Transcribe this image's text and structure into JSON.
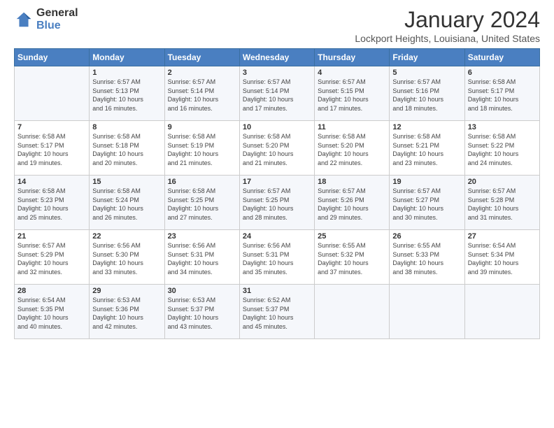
{
  "logo": {
    "general": "General",
    "blue": "Blue"
  },
  "title": "January 2024",
  "location": "Lockport Heights, Louisiana, United States",
  "days_of_week": [
    "Sunday",
    "Monday",
    "Tuesday",
    "Wednesday",
    "Thursday",
    "Friday",
    "Saturday"
  ],
  "weeks": [
    [
      {
        "day": "",
        "info": ""
      },
      {
        "day": "1",
        "info": "Sunrise: 6:57 AM\nSunset: 5:13 PM\nDaylight: 10 hours\nand 16 minutes."
      },
      {
        "day": "2",
        "info": "Sunrise: 6:57 AM\nSunset: 5:14 PM\nDaylight: 10 hours\nand 16 minutes."
      },
      {
        "day": "3",
        "info": "Sunrise: 6:57 AM\nSunset: 5:14 PM\nDaylight: 10 hours\nand 17 minutes."
      },
      {
        "day": "4",
        "info": "Sunrise: 6:57 AM\nSunset: 5:15 PM\nDaylight: 10 hours\nand 17 minutes."
      },
      {
        "day": "5",
        "info": "Sunrise: 6:57 AM\nSunset: 5:16 PM\nDaylight: 10 hours\nand 18 minutes."
      },
      {
        "day": "6",
        "info": "Sunrise: 6:58 AM\nSunset: 5:17 PM\nDaylight: 10 hours\nand 18 minutes."
      }
    ],
    [
      {
        "day": "7",
        "info": "Sunrise: 6:58 AM\nSunset: 5:17 PM\nDaylight: 10 hours\nand 19 minutes."
      },
      {
        "day": "8",
        "info": "Sunrise: 6:58 AM\nSunset: 5:18 PM\nDaylight: 10 hours\nand 20 minutes."
      },
      {
        "day": "9",
        "info": "Sunrise: 6:58 AM\nSunset: 5:19 PM\nDaylight: 10 hours\nand 21 minutes."
      },
      {
        "day": "10",
        "info": "Sunrise: 6:58 AM\nSunset: 5:20 PM\nDaylight: 10 hours\nand 21 minutes."
      },
      {
        "day": "11",
        "info": "Sunrise: 6:58 AM\nSunset: 5:20 PM\nDaylight: 10 hours\nand 22 minutes."
      },
      {
        "day": "12",
        "info": "Sunrise: 6:58 AM\nSunset: 5:21 PM\nDaylight: 10 hours\nand 23 minutes."
      },
      {
        "day": "13",
        "info": "Sunrise: 6:58 AM\nSunset: 5:22 PM\nDaylight: 10 hours\nand 24 minutes."
      }
    ],
    [
      {
        "day": "14",
        "info": "Sunrise: 6:58 AM\nSunset: 5:23 PM\nDaylight: 10 hours\nand 25 minutes."
      },
      {
        "day": "15",
        "info": "Sunrise: 6:58 AM\nSunset: 5:24 PM\nDaylight: 10 hours\nand 26 minutes."
      },
      {
        "day": "16",
        "info": "Sunrise: 6:58 AM\nSunset: 5:25 PM\nDaylight: 10 hours\nand 27 minutes."
      },
      {
        "day": "17",
        "info": "Sunrise: 6:57 AM\nSunset: 5:25 PM\nDaylight: 10 hours\nand 28 minutes."
      },
      {
        "day": "18",
        "info": "Sunrise: 6:57 AM\nSunset: 5:26 PM\nDaylight: 10 hours\nand 29 minutes."
      },
      {
        "day": "19",
        "info": "Sunrise: 6:57 AM\nSunset: 5:27 PM\nDaylight: 10 hours\nand 30 minutes."
      },
      {
        "day": "20",
        "info": "Sunrise: 6:57 AM\nSunset: 5:28 PM\nDaylight: 10 hours\nand 31 minutes."
      }
    ],
    [
      {
        "day": "21",
        "info": "Sunrise: 6:57 AM\nSunset: 5:29 PM\nDaylight: 10 hours\nand 32 minutes."
      },
      {
        "day": "22",
        "info": "Sunrise: 6:56 AM\nSunset: 5:30 PM\nDaylight: 10 hours\nand 33 minutes."
      },
      {
        "day": "23",
        "info": "Sunrise: 6:56 AM\nSunset: 5:31 PM\nDaylight: 10 hours\nand 34 minutes."
      },
      {
        "day": "24",
        "info": "Sunrise: 6:56 AM\nSunset: 5:31 PM\nDaylight: 10 hours\nand 35 minutes."
      },
      {
        "day": "25",
        "info": "Sunrise: 6:55 AM\nSunset: 5:32 PM\nDaylight: 10 hours\nand 37 minutes."
      },
      {
        "day": "26",
        "info": "Sunrise: 6:55 AM\nSunset: 5:33 PM\nDaylight: 10 hours\nand 38 minutes."
      },
      {
        "day": "27",
        "info": "Sunrise: 6:54 AM\nSunset: 5:34 PM\nDaylight: 10 hours\nand 39 minutes."
      }
    ],
    [
      {
        "day": "28",
        "info": "Sunrise: 6:54 AM\nSunset: 5:35 PM\nDaylight: 10 hours\nand 40 minutes."
      },
      {
        "day": "29",
        "info": "Sunrise: 6:53 AM\nSunset: 5:36 PM\nDaylight: 10 hours\nand 42 minutes."
      },
      {
        "day": "30",
        "info": "Sunrise: 6:53 AM\nSunset: 5:37 PM\nDaylight: 10 hours\nand 43 minutes."
      },
      {
        "day": "31",
        "info": "Sunrise: 6:52 AM\nSunset: 5:37 PM\nDaylight: 10 hours\nand 45 minutes."
      },
      {
        "day": "",
        "info": ""
      },
      {
        "day": "",
        "info": ""
      },
      {
        "day": "",
        "info": ""
      }
    ]
  ]
}
